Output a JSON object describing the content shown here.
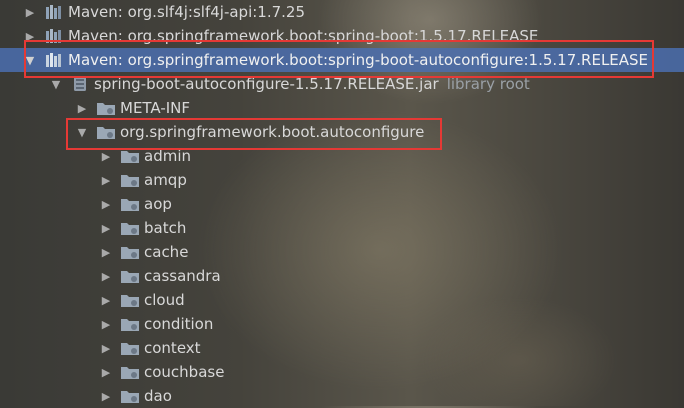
{
  "tree": {
    "rows": [
      {
        "label": "Maven: org.slf4j:slf4j-api:1.7.25",
        "icon": "library-icon",
        "expanded": false
      },
      {
        "label": "Maven: org.springframework.boot:spring-boot:1.5.17.RELEASE",
        "icon": "library-icon",
        "expanded": false
      },
      {
        "label": "Maven: org.springframework.boot:spring-boot-autoconfigure:1.5.17.RELEASE",
        "icon": "library-icon",
        "expanded": true,
        "selected": true
      },
      {
        "label": "spring-boot-autoconfigure-1.5.17.RELEASE.jar",
        "suffix": "library root",
        "icon": "jar-icon",
        "expanded": true
      },
      {
        "label": "META-INF",
        "icon": "package-icon",
        "expanded": false
      },
      {
        "label": "org.springframework.boot.autoconfigure",
        "icon": "package-icon",
        "expanded": true
      },
      {
        "label": "admin",
        "icon": "package-icon",
        "expanded": false
      },
      {
        "label": "amqp",
        "icon": "package-icon",
        "expanded": false
      },
      {
        "label": "aop",
        "icon": "package-icon",
        "expanded": false
      },
      {
        "label": "batch",
        "icon": "package-icon",
        "expanded": false
      },
      {
        "label": "cache",
        "icon": "package-icon",
        "expanded": false
      },
      {
        "label": "cassandra",
        "icon": "package-icon",
        "expanded": false
      },
      {
        "label": "cloud",
        "icon": "package-icon",
        "expanded": false
      },
      {
        "label": "condition",
        "icon": "package-icon",
        "expanded": false
      },
      {
        "label": "context",
        "icon": "package-icon",
        "expanded": false
      },
      {
        "label": "couchbase",
        "icon": "package-icon",
        "expanded": false
      },
      {
        "label": "dao",
        "icon": "package-icon",
        "expanded": false
      }
    ]
  },
  "colors": {
    "selection": "#4b6eaf",
    "annotation": "#e53935",
    "text": "#d8d8d8",
    "muted": "#9aa0a6"
  }
}
